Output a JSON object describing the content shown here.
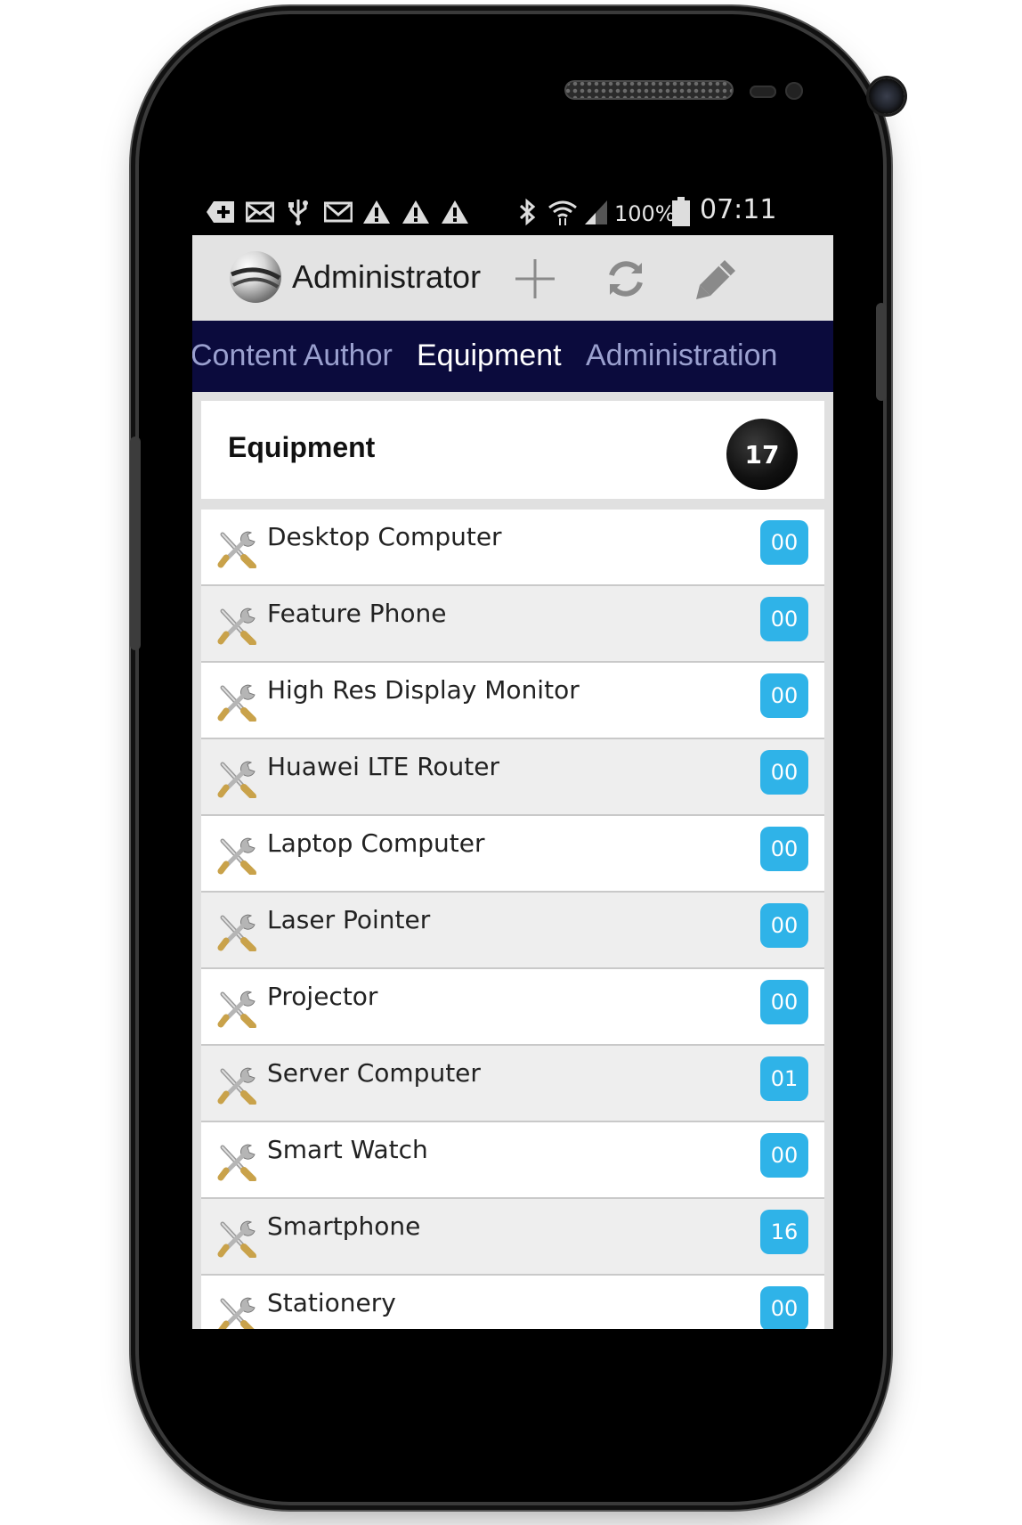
{
  "status_bar": {
    "battery": "100%",
    "time": "07:11"
  },
  "action_bar": {
    "title": "Administrator"
  },
  "tabs": [
    {
      "label": "Content Author"
    },
    {
      "label": "Equipment"
    },
    {
      "label": "Administration"
    }
  ],
  "active_tab": "Equipment",
  "header": {
    "title": "Equipment",
    "count": "17"
  },
  "badge_color": "#2fb3e8",
  "items": [
    {
      "label": "Desktop Computer",
      "count": "00"
    },
    {
      "label": "Feature Phone",
      "count": "00"
    },
    {
      "label": "High Res Display Monitor",
      "count": "00"
    },
    {
      "label": "Huawei LTE Router",
      "count": "00"
    },
    {
      "label": "Laptop Computer",
      "count": "00"
    },
    {
      "label": "Laser Pointer",
      "count": "00"
    },
    {
      "label": "Projector",
      "count": "00"
    },
    {
      "label": "Server Computer",
      "count": "01"
    },
    {
      "label": "Smart Watch",
      "count": "00"
    },
    {
      "label": "Smartphone",
      "count": "16"
    },
    {
      "label": "Stationery",
      "count": "00"
    }
  ]
}
